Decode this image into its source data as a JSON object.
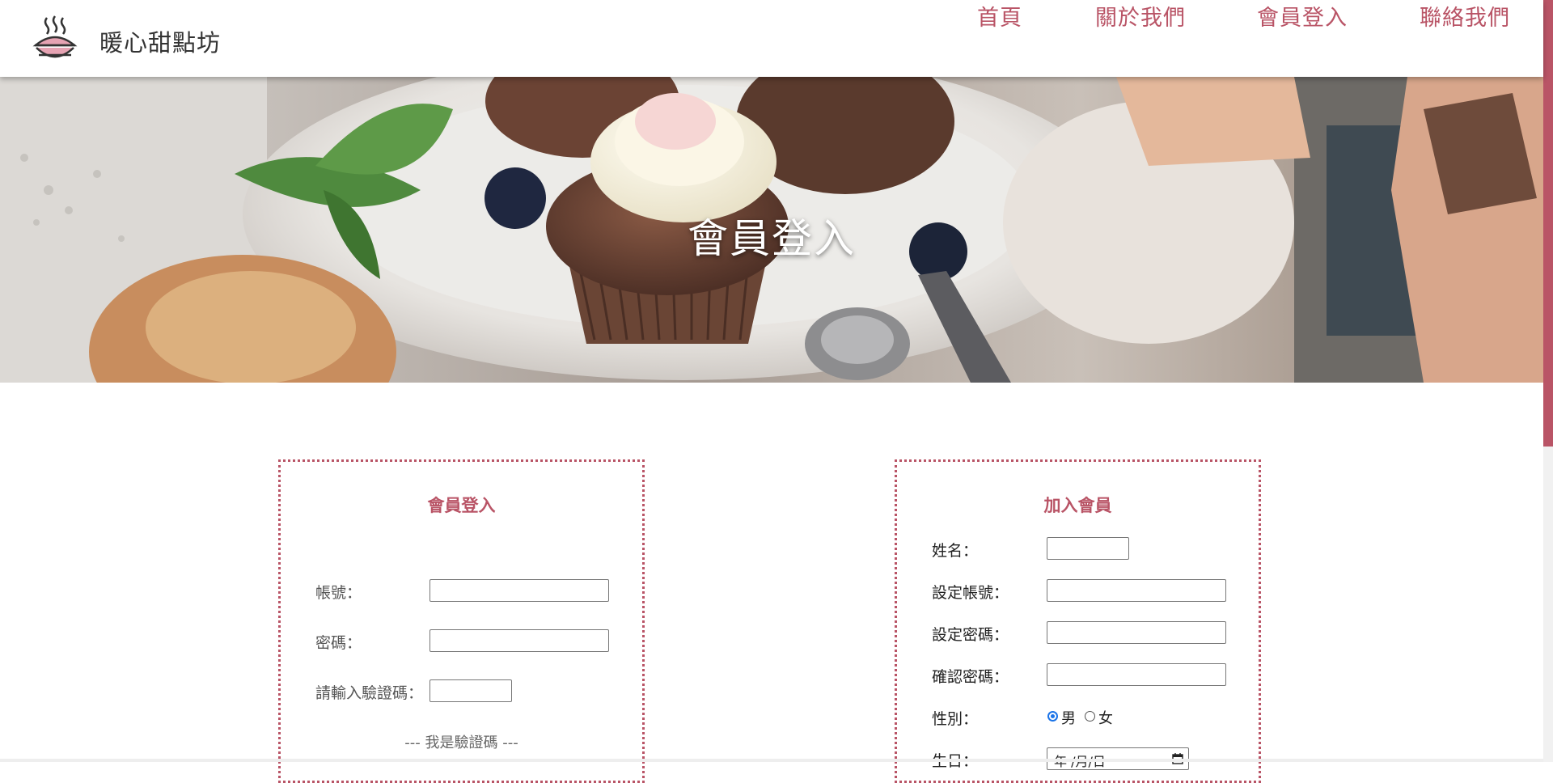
{
  "header": {
    "brand": "暖心甜點坊",
    "logo_icon": "pie-steam-icon",
    "nav": [
      {
        "label": "首頁"
      },
      {
        "label": "關於我們"
      },
      {
        "label": "會員登入"
      },
      {
        "label": "聯絡我們"
      }
    ]
  },
  "hero": {
    "title": "會員登入",
    "image": "cupcake-plate-photo"
  },
  "login": {
    "title": "會員登入",
    "account_label": "帳號：",
    "account_value": "",
    "password_label": "密碼：",
    "password_value": "",
    "captcha_label": "請輸入驗證碼：",
    "captcha_value": "",
    "captcha_text": "--- 我是驗證碼 ---"
  },
  "register": {
    "title": "加入會員",
    "name_label": "姓名：",
    "account_label": "設定帳號：",
    "password_label": "設定密碼：",
    "confirm_label": "確認密碼：",
    "gender_label": "性別：",
    "gender_options": [
      "男",
      "女"
    ],
    "gender_selected": "男",
    "birthday_label": "生日：",
    "birthday_placeholder": "年 /月/日"
  },
  "colors": {
    "accent": "#b95466",
    "scrollbar_thumb": "#b95466"
  }
}
